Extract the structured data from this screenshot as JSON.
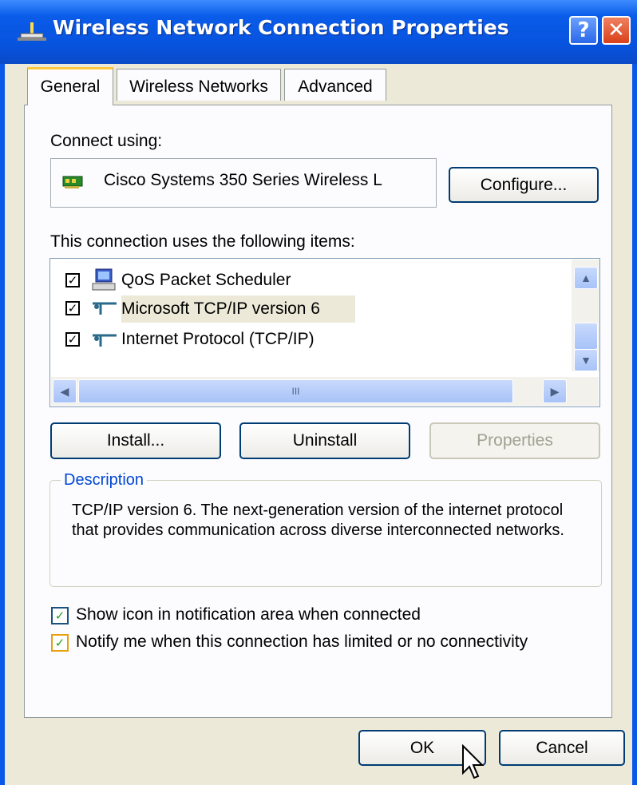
{
  "window": {
    "title": "Wireless Network Connection Properties",
    "help_label": "?",
    "close_label": "✕"
  },
  "tabs": [
    {
      "label": "General",
      "active": true
    },
    {
      "label": "Wireless Networks",
      "active": false
    },
    {
      "label": "Advanced",
      "active": false
    }
  ],
  "general": {
    "connect_using_label": "Connect using:",
    "adapter_name": "Cisco Systems 350 Series Wireless L",
    "configure_label": "Configure...",
    "items_label": "This connection uses the following items:",
    "items": [
      {
        "label": "QoS Packet Scheduler",
        "checked": true,
        "icon": "computer-icon"
      },
      {
        "label": "Microsoft TCP/IP version 6",
        "checked": true,
        "icon": "network-protocol-icon",
        "selected": true
      },
      {
        "label": "Internet Protocol (TCP/IP)",
        "checked": true,
        "icon": "network-protocol-icon"
      }
    ],
    "hscroll_grip": "III",
    "install_label": "Install...",
    "uninstall_label": "Uninstall",
    "properties_label": "Properties",
    "description_title": "Description",
    "description_text": "TCP/IP version 6. The next-generation version of the internet protocol that provides communication across diverse interconnected networks.",
    "show_icon_label": "Show icon in notification area when connected",
    "notify_label": "Notify me when this connection has limited or no connectivity"
  },
  "footer": {
    "ok_label": "OK",
    "cancel_label": "Cancel"
  },
  "colors": {
    "titlebar": "#0a58e8",
    "dialog_face": "#ece9d8",
    "tab_accent": "#ffc83c",
    "description_title": "#0046d5"
  }
}
